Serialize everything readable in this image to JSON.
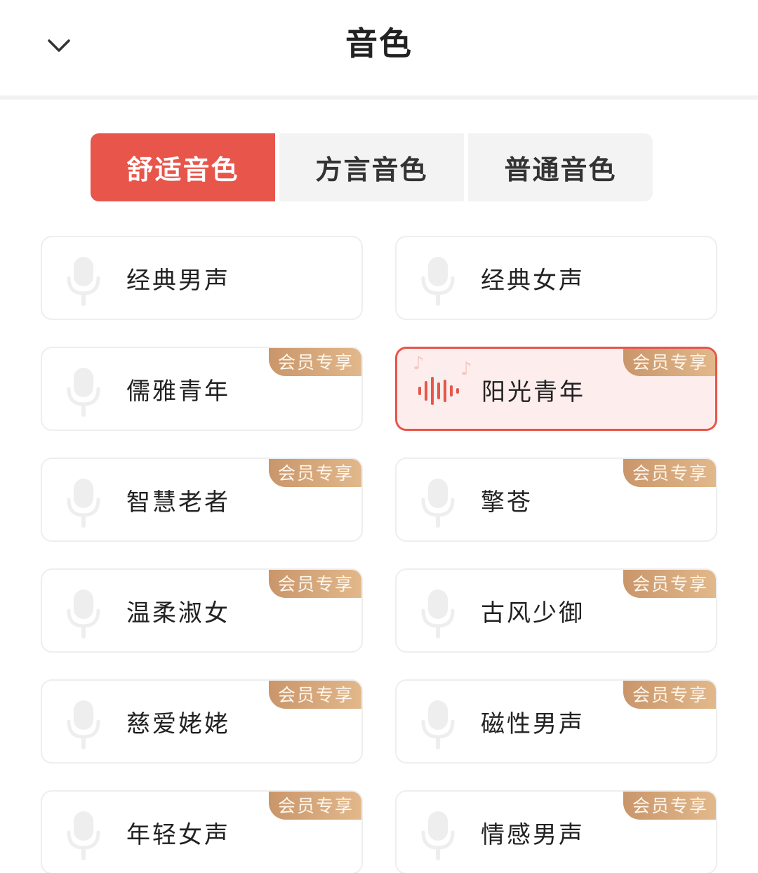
{
  "header": {
    "title": "音色"
  },
  "tabs": [
    {
      "label": "舒适音色",
      "active": true
    },
    {
      "label": "方言音色",
      "active": false
    },
    {
      "label": "普通音色",
      "active": false
    }
  ],
  "voices": [
    {
      "name": "经典男声",
      "badge": "",
      "selected": false
    },
    {
      "name": "经典女声",
      "badge": "",
      "selected": false
    },
    {
      "name": "儒雅青年",
      "badge": "会员专享",
      "selected": false
    },
    {
      "name": "阳光青年",
      "badge": "会员专享",
      "selected": true
    },
    {
      "name": "智慧老者",
      "badge": "会员专享",
      "selected": false
    },
    {
      "name": "擎苍",
      "badge": "会员专享",
      "selected": false
    },
    {
      "name": "温柔淑女",
      "badge": "会员专享",
      "selected": false
    },
    {
      "name": "古风少御",
      "badge": "会员专享",
      "selected": false
    },
    {
      "name": "慈爱姥姥",
      "badge": "会员专享",
      "selected": false
    },
    {
      "name": "磁性男声",
      "badge": "会员专享",
      "selected": false
    },
    {
      "name": "年轻女声",
      "badge": "会员专享",
      "selected": false
    },
    {
      "name": "情感男声",
      "badge": "会员专享",
      "selected": false
    }
  ],
  "colors": {
    "accent": "#e8554a",
    "badge_gradient_start": "#c9966a",
    "badge_gradient_end": "#e2b98c"
  }
}
